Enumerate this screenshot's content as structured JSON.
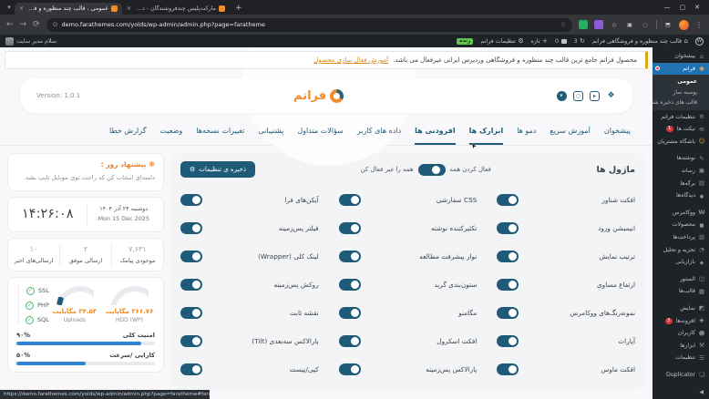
{
  "browser": {
    "tabs": [
      {
        "title": "عمومی ، قالب چند منظوره و فرو…"
      },
      {
        "title": "مارکت‌پلیس چندفروشندگان - دمو…"
      }
    ],
    "url": "demo.farathemes.com/yolds/wp-admin/admin.php?page=faratheme"
  },
  "adminbar": {
    "site_name": "قالب چند منظوره و فروشگاهی فراتم",
    "updates_count": "3",
    "comments_count": "0",
    "new_label": "تازه",
    "settings_label": "تنظیمات فراتم",
    "live_badge": "زنده",
    "greeting": "سلام مدیر سایت"
  },
  "sidebar": {
    "top": [
      {
        "label": "پیشخوان",
        "icon": "dashboard-icon"
      },
      {
        "label": "فراتم",
        "icon": "faratheme-icon",
        "state": "active",
        "dot": true
      }
    ],
    "submenu": [
      {
        "label": "عمومی",
        "state": "current"
      },
      {
        "label": "پوسته ساز"
      },
      {
        "label": "قالب های ذخیره شده"
      }
    ],
    "items": [
      {
        "label": "تنظیمات فراتم",
        "icon": "fara-settings-icon"
      },
      {
        "label": "تیکت ها",
        "icon": "tickets-icon",
        "badge": "1"
      },
      {
        "label": "باشگاه مشتریان",
        "icon": "customers-icon"
      },
      {
        "label": "نوشته‌ها",
        "icon": "posts-icon",
        "sep": "sep"
      },
      {
        "label": "رسانه",
        "icon": "media-icon"
      },
      {
        "label": "برگه‌ها",
        "icon": "pages-icon"
      },
      {
        "label": "دیدگاه‌ها",
        "icon": "comments-icon"
      },
      {
        "label": "ووکامرس",
        "icon": "woocommerce-icon",
        "sep": "sep"
      },
      {
        "label": "محصولات",
        "icon": "products-icon"
      },
      {
        "label": "پرداخت‌ها",
        "icon": "payments-icon"
      },
      {
        "label": "تجزیه و تحلیل",
        "icon": "analytics-icon"
      },
      {
        "label": "بازاریابی",
        "icon": "marketing-icon"
      },
      {
        "label": "المنتور",
        "icon": "elementor-icon",
        "sep": "sep"
      },
      {
        "label": "قالب‌ها",
        "icon": "templates-icon"
      },
      {
        "label": "نمایش",
        "icon": "appearance-icon",
        "sep": "sep"
      },
      {
        "label": "افزونه‌ها",
        "icon": "plugins-icon",
        "badge": "3"
      },
      {
        "label": "کاربران",
        "icon": "users-icon"
      },
      {
        "label": "ابزارها",
        "icon": "tools-icon"
      },
      {
        "label": "تنظیمات",
        "icon": "settings-icon"
      },
      {
        "label": "Duplicator",
        "icon": "duplicator-icon",
        "sep": "sep"
      }
    ]
  },
  "notice": {
    "text": "محصول فراتم جامع ترین قالب چند منظوره و فروشگاهی وردپرس ایرانی غیرفعال می باشد.",
    "link": "آموزش فعال سازی محصول"
  },
  "header": {
    "logo_text": "فراتم",
    "version": "Version: 1.0.1",
    "socials": [
      "aparat-icon",
      "youtube-icon",
      "instagram-icon",
      "telegram-icon"
    ]
  },
  "tabs": [
    {
      "label": "پیشخوان"
    },
    {
      "label": "آموزش سریع"
    },
    {
      "label": "دمو ها"
    },
    {
      "label": "ابزارک ها",
      "state": "hover",
      "cursor": true
    },
    {
      "label": "افزودنی ها",
      "state": "active"
    },
    {
      "label": "داده های کاربر"
    },
    {
      "label": "سؤالات متداول"
    },
    {
      "label": "پشتیبانی"
    },
    {
      "label": "تغییرات نسخه‌ها"
    },
    {
      "label": "وضعیت"
    },
    {
      "label": "گزارش خطا"
    }
  ],
  "modules": {
    "title": "ماژول ها",
    "enable_all_label": "فعال کردن همه",
    "disable_all_label": "همه را غیر فعال کن",
    "save_button": "ذخیره ی تنظیمات",
    "items": [
      "افکت شناور",
      "CSS سفارشی",
      "آیکن‌های فرا",
      "انیمیشن ورود",
      "تکثیرکننده نوشته",
      "فیلتر پس‌زمینه",
      "ترتیب نمایش",
      "نوار پیشرفت مطالعه",
      "لینک کلی (Wrapper)",
      "ارتفاع مساوی",
      "ستون‌بندی گرید",
      "روکش پس‌زمینه",
      "نمونه‌رنگ‌های ووکامرس",
      "مگامنو",
      "نقشه ثابت",
      "آپارات",
      "افکت اسکرول",
      "پارالاکس سه‌بعدی (Tilt)",
      "افکت ماوس",
      "پارالاکس پس‌زمینه",
      "کپی/پیست"
    ]
  },
  "widgets": {
    "tip": {
      "title": "پیشنهاد روز :",
      "body": "دامنه‌ای انتخاب کن که راحت توی موبایل تایپ بشه."
    },
    "clock": {
      "time": "۱۴:۲۶:۰۸",
      "date_fa": "دوشنبه ۲۴ آذر ۱۴۰۴",
      "date_en": "Mon 15 Dec 2025"
    },
    "stats": [
      {
        "value": "۷,۶۳۱",
        "label": "موجودی پیامک"
      },
      {
        "value": "۲",
        "label": "ارسالی موفق"
      },
      {
        "value": "۱۰",
        "label": "ارسالی‌های اخیر"
      }
    ],
    "security": {
      "checks": [
        "SSL",
        "PHP",
        "SQL"
      ],
      "gauges": [
        {
          "value": "۳۶۶.۷۶ مگابایت",
          "label": "HDD (WP)"
        },
        {
          "value": "۳۴.۵۳ مگابایت",
          "label": "Uploads",
          "marker": true
        }
      ],
      "bars": [
        {
          "label": "امنیت کلی",
          "percent": "۹۰%",
          "width": 90
        },
        {
          "label": "کارایی /سرعت",
          "percent": "۵۰%",
          "width": 50
        }
      ]
    }
  },
  "statusbar": {
    "url": "https://demo.farathemes.com/yolds/wp-admin/admin.php?page=faratheme#fara-widgets"
  }
}
